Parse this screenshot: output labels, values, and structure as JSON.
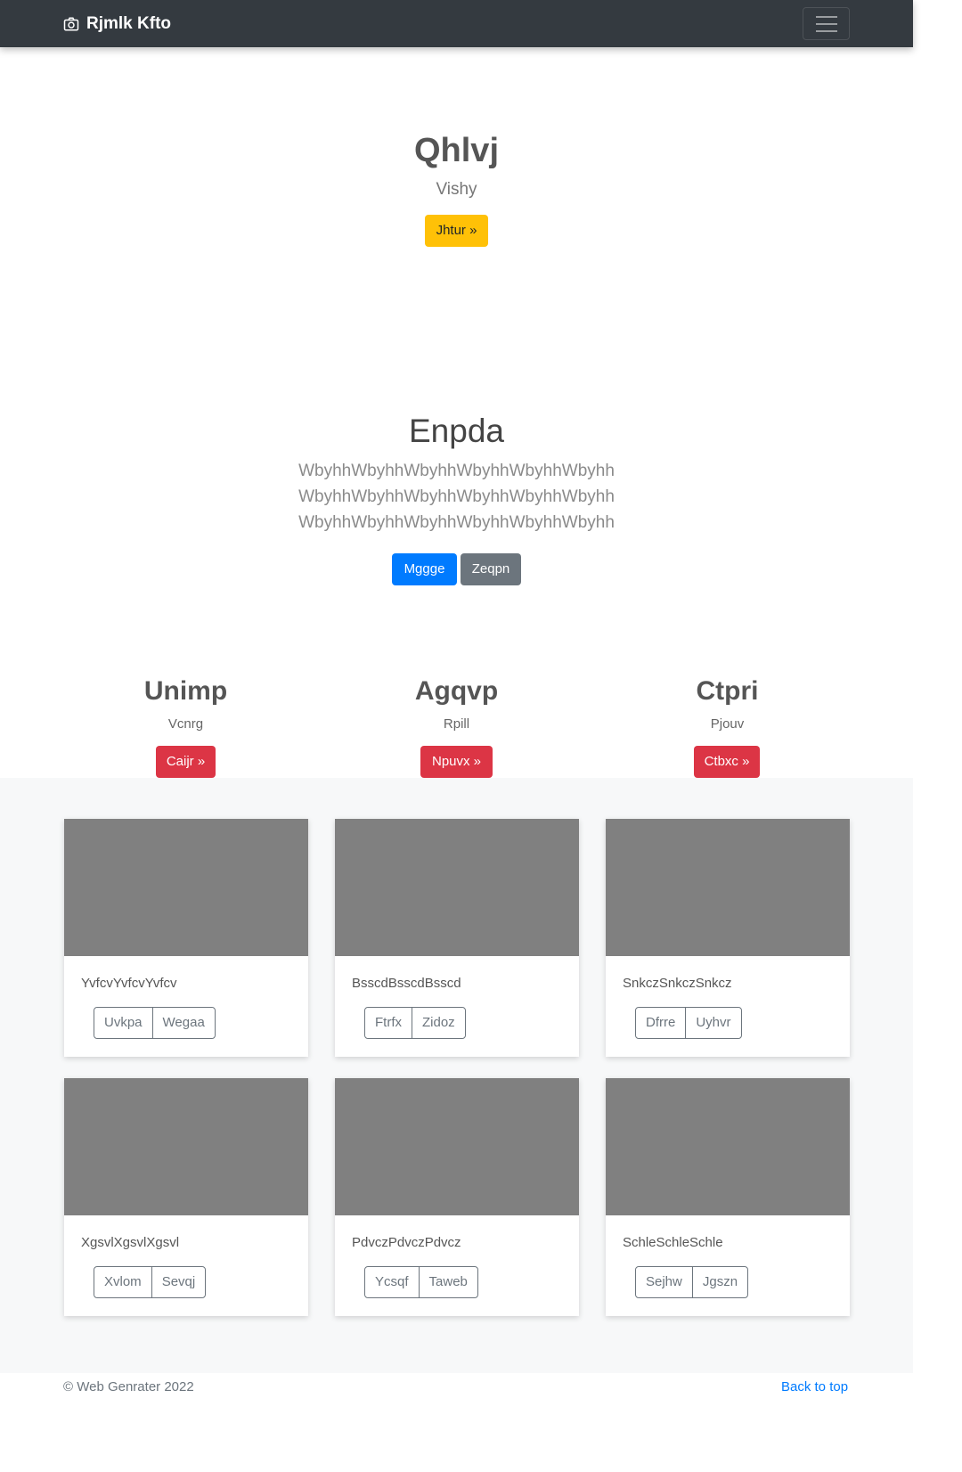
{
  "navbar": {
    "brand": "Rjmlk Kfto",
    "brand_icon": "camera-icon",
    "toggler_icon": "hamburger-menu-icon"
  },
  "hero": {
    "title": "Qhlvj",
    "subtitle": "Vishy",
    "button": "Jhtur »"
  },
  "jumbo": {
    "title": "Enpda",
    "lines": [
      "WbyhhWbyhhWbyhhWbyhhWbyhhWbyhh",
      "WbyhhWbyhhWbyhhWbyhhWbyhhWbyhh",
      "WbyhhWbyhhWbyhhWbyhhWbyhhWbyhh"
    ],
    "primary_button": "Mggge",
    "secondary_button": "Zeqpn"
  },
  "columns": [
    {
      "title": "Unimp",
      "text": "Vcnrg",
      "button": "Caijr »"
    },
    {
      "title": "Agqvp",
      "text": "Rpill",
      "button": "Npuvx »"
    },
    {
      "title": "Ctpri",
      "text": "Pjouv",
      "button": "Ctbxc »"
    }
  ],
  "cards": [
    {
      "text": "YvfcvYvfcvYvfcv",
      "buttons": [
        "Uvkpa",
        "Wegaa"
      ]
    },
    {
      "text": "BsscdBsscdBsscd",
      "buttons": [
        "Ftrfx",
        "Zidoz"
      ]
    },
    {
      "text": "SnkczSnkczSnkcz",
      "buttons": [
        "Dfrre",
        "Uyhvr"
      ]
    },
    {
      "text": "XgsvlXgsvlXgsvl",
      "buttons": [
        "Xvlom",
        "Sevqj"
      ]
    },
    {
      "text": "PdvczPdvczPdvcz",
      "buttons": [
        "Ycsqf",
        "Taweb"
      ]
    },
    {
      "text": "SchleSchleSchle",
      "buttons": [
        "Sejhw",
        "Jgszn"
      ]
    }
  ],
  "footer": {
    "copyright": "© Web Genrater 2022",
    "back_to_top": "Back to top"
  },
  "colors": {
    "navbar": "#343a40",
    "warning": "#ffc107",
    "primary": "#007bff",
    "secondary": "#6c757d",
    "danger": "#dc3545",
    "thumb": "#808080"
  }
}
